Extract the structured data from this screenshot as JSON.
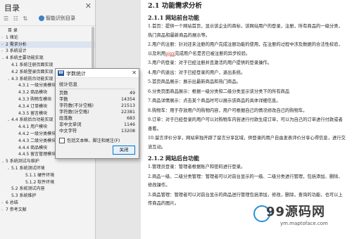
{
  "nav": {
    "title": "目录",
    "smart_label": "智能识别目录",
    "items": [
      {
        "text": "目  录",
        "level": "l0c",
        "caret": ""
      },
      {
        "text": "1 绪论",
        "level": "l0",
        "caret": "›"
      },
      {
        "text": "2 需求分析",
        "level": "l0",
        "caret": "›",
        "active": true
      },
      {
        "text": "3 系统设计",
        "level": "l0",
        "caret": "›"
      },
      {
        "text": "4 系统主要功能实现",
        "level": "l0",
        "caret": "⌄"
      },
      {
        "text": "4.1 系统注册页面实现",
        "level": "l1",
        "caret": ""
      },
      {
        "text": "4.2 系统登录页面实现",
        "level": "l1",
        "caret": ""
      },
      {
        "text": "4.3 系统前台功能实现",
        "level": "l1",
        "caret": "⌄"
      },
      {
        "text": "4.3.1 一级分类模块",
        "level": "l2",
        "caret": ""
      },
      {
        "text": "4.3.2 商品模块",
        "level": "l2",
        "caret": ""
      },
      {
        "text": "4.3.3 购物车模块",
        "level": "l2",
        "caret": ""
      },
      {
        "text": "4.3.4 订单模块",
        "level": "l2",
        "caret": ""
      },
      {
        "text": "4.3.5 留言模块",
        "level": "l2",
        "caret": ""
      },
      {
        "text": "4.4 系统后台功能实现",
        "level": "l1",
        "caret": "⌄"
      },
      {
        "text": "4.4.1 用户模块",
        "level": "l2",
        "caret": ""
      },
      {
        "text": "4.4.2 一级分类模块",
        "level": "l2",
        "caret": ""
      },
      {
        "text": "4.4.3 二级分类模块",
        "level": "l2",
        "caret": ""
      },
      {
        "text": "4.4.4 商品模块",
        "level": "l2",
        "caret": ""
      },
      {
        "text": "4.4.5 留言管理模块",
        "level": "l2",
        "caret": ""
      },
      {
        "text": "5 系统测试与维护",
        "level": "l0",
        "caret": "⌄"
      },
      {
        "text": "5.1 系统测试环境",
        "level": "l1",
        "caret": "⌄"
      },
      {
        "text": "5.1.1 硬件环境",
        "level": "l3",
        "caret": ""
      },
      {
        "text": "5.1.2 软件环境",
        "level": "l3",
        "caret": ""
      },
      {
        "text": "5.2 系统测试内容",
        "level": "l1",
        "caret": ""
      },
      {
        "text": "5.3 系统维护",
        "level": "l1",
        "caret": ""
      },
      {
        "text": "6 总结",
        "level": "l0",
        "caret": "›"
      },
      {
        "text": "7 参考文献",
        "level": "l0",
        "caret": "›"
      }
    ]
  },
  "doc": {
    "heading": "2.1 功能需求分析",
    "sub1": "2.1.1 网站前台功能",
    "p1": "1.首页：提供一个网站首页，显示该企业的商标，该网站用户的登录，注册，所有商品的一级分类，热门商品和最新商品的展示等。",
    "p2a": "2.用户的注册：针对还未注册的用户完成注册功能的使用，在注册的过程中涉及数据的合法性校验，以及利用",
    "p2red": "ajax",
    "p2b": "完成用户名是否已被注册的异步校验。",
    "p3": "3.用户的登录：对于已经注册并且激活的用户提供的登录操作。",
    "p4": "4.用户的退出：对于已经登录的用户，退出系统。",
    "p5": "5.首页商品展示：展示出最新商品和热门商品。",
    "p6": "6.分类页面商品展示：根据一级分类和二级分类显示该分类下的所有商品",
    "p7": "7.商品详情展示：点击某个商品时可以展示该商品的具体详细信息。",
    "p8": "8.购物车：用于存放用户的购物内容，用户可根据自己的情况修改自己的购物车。",
    "p9": "9.订单：对于已经登录的用户可以对购物车内容进行付款生成订单，可以为自己的订单进行付款或者查看。",
    "p10": "10.留言评价分享，网站单独开辟了留言分享区域，供登录的用户自由发表评价分享心得信息，进行交流互动。",
    "sub2": "2.1.2 网站后台功能",
    "q1": "1.管理员登录：管理者根据账户和密码进行登录。",
    "q2": "2.商品一级、二级分类管理：管理者可以对前台显示的一级、二级分类进行管理，包括添加、删除、修改操作。",
    "q3": "3.商品管理：管理者可以对前台显示的商品进行管理包括添加，修改，删除，查询的功能，也可以上传商品的图片。"
  },
  "dialog": {
    "title": "字数统计",
    "stats_label": "统计信息",
    "stats": [
      {
        "label": "页数",
        "value": "49"
      },
      {
        "label": "字数",
        "value": "14354"
      },
      {
        "label": "字符数(不计空格)",
        "value": "21513"
      },
      {
        "label": "字符数(计空格)",
        "value": "22381"
      },
      {
        "label": "段落数",
        "value": "683"
      },
      {
        "label": "非中文单词",
        "value": "1146"
      },
      {
        "label": "中文字符",
        "value": "13208"
      }
    ],
    "include_label": "包括文本框、脚注和尾注(F)",
    "close_label": "关闭"
  },
  "watermark": {
    "text": "99源码网",
    "url": "ym.maptoface.com"
  }
}
